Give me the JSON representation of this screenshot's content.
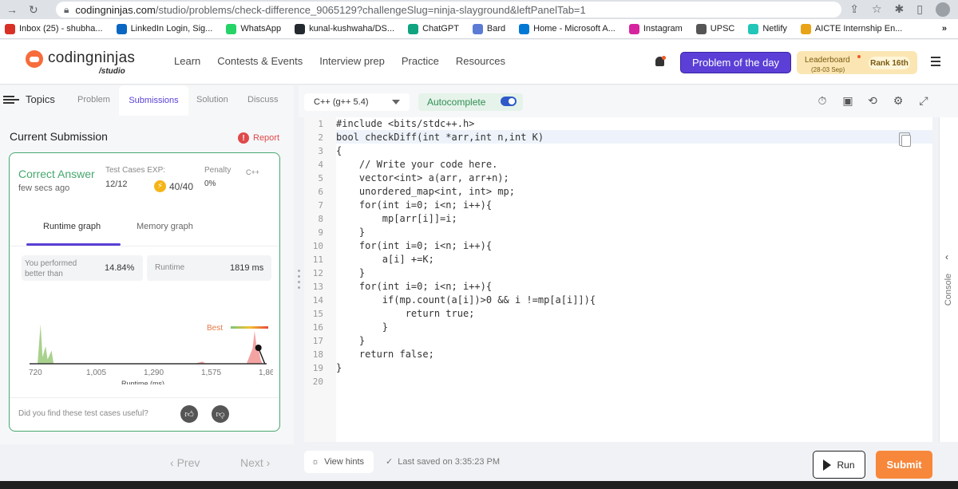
{
  "browser": {
    "url_host": "codingninjas.com",
    "url_path": "/studio/problems/check-difference_9065129?challengeSlug=ninja-slayground&leftPanelTab=1"
  },
  "bookmarks": [
    {
      "label": "Inbox (25) - shubha...",
      "color": "#d93025"
    },
    {
      "label": "LinkedIn Login, Sig...",
      "color": "#0a66c2"
    },
    {
      "label": "WhatsApp",
      "color": "#25d366"
    },
    {
      "label": "kunal-kushwaha/DS...",
      "color": "#24292f"
    },
    {
      "label": "ChatGPT",
      "color": "#10a37f"
    },
    {
      "label": "Bard",
      "color": "#5b7bd5"
    },
    {
      "label": "Home - Microsoft A...",
      "color": "#0078d4"
    },
    {
      "label": "Instagram",
      "color": "#d6249f"
    },
    {
      "label": "UPSC",
      "color": "#555555"
    },
    {
      "label": "Netlify",
      "color": "#20c6b7"
    },
    {
      "label": "AICTE Internship En...",
      "color": "#e8a317"
    }
  ],
  "bookmarks_more": "»",
  "header": {
    "brand": "codingninjas",
    "brand_sub": "/studio",
    "nav": [
      "Learn",
      "Contests & Events",
      "Interview prep",
      "Practice",
      "Resources"
    ],
    "potd": "Problem of the day",
    "leaderboard": "Leaderboard",
    "leaderboard_date": "(28-03 Sep)",
    "rank": "Rank 16th"
  },
  "left": {
    "topics": "Topics",
    "tabs": [
      "Problem",
      "Submissions",
      "Solution",
      "Discuss"
    ],
    "current_submission": "Current Submission",
    "report": "Report",
    "result": "Correct Answer",
    "time_ago": "few secs ago",
    "test_cases_label": "Test Cases",
    "exp_label": "EXP:",
    "test_cases_value": "12/12",
    "points": "40/40",
    "penalty_label": "Penalty",
    "penalty_value": "0%",
    "language": "C++",
    "graph_tabs": [
      "Runtime graph",
      "Memory graph"
    ],
    "performed_label": "You performed better than",
    "performed_value": "14.84%",
    "runtime_label": "Runtime",
    "runtime_value": "1819 ms",
    "useful_question": "Did you find these test cases useful?",
    "prev": "Prev",
    "next": "Next"
  },
  "chart_data": {
    "type": "area",
    "xlabel": "Runtime (ms)",
    "ticks": [
      "720",
      "1,005",
      "1,290",
      "1,575",
      "1,860"
    ],
    "xlim": [
      720,
      1860
    ],
    "best_label": "Best",
    "user_runtime": 1819,
    "series": [
      {
        "color": "#a9d18e",
        "points": [
          [
            720,
            0
          ],
          [
            735,
            0.9
          ],
          [
            745,
            0.15
          ],
          [
            760,
            0.4
          ],
          [
            770,
            0.1
          ],
          [
            790,
            0.3
          ],
          [
            800,
            0
          ],
          [
            1860,
            0
          ]
        ]
      },
      {
        "color": "#f4a3a3",
        "points": [
          [
            1500,
            0
          ],
          [
            1540,
            0.05
          ],
          [
            1560,
            0
          ],
          [
            1760,
            0
          ],
          [
            1790,
            0.35
          ],
          [
            1800,
            0.75
          ],
          [
            1810,
            0.4
          ],
          [
            1819,
            0.35
          ],
          [
            1830,
            0.1
          ],
          [
            1840,
            0
          ]
        ]
      }
    ]
  },
  "editor": {
    "language": "C++ (g++ 5.4)",
    "autocomplete": "Autocomplete",
    "lines": [
      "#include <bits/stdc++.h>",
      "bool checkDiff(int *arr,int n,int K)",
      "{",
      "    // Write your code here.",
      "    vector<int> a(arr, arr+n);",
      "    unordered_map<int, int> mp;",
      "    for(int i=0; i<n; i++){",
      "        mp[arr[i]]=i;",
      "    }",
      "    for(int i=0; i<n; i++){",
      "        a[i] +=K;",
      "    }",
      "    for(int i=0; i<n; i++){",
      "        if(mp.count(a[i])>0 && i !=mp[a[i]]){",
      "            return true;",
      "        }",
      "    }",
      "    return false;",
      "}",
      ""
    ],
    "console": "Console"
  },
  "bottom": {
    "view_hints": "View hints",
    "last_saved": "Last saved on 3:35:23 PM",
    "run": "Run",
    "submit": "Submit"
  }
}
